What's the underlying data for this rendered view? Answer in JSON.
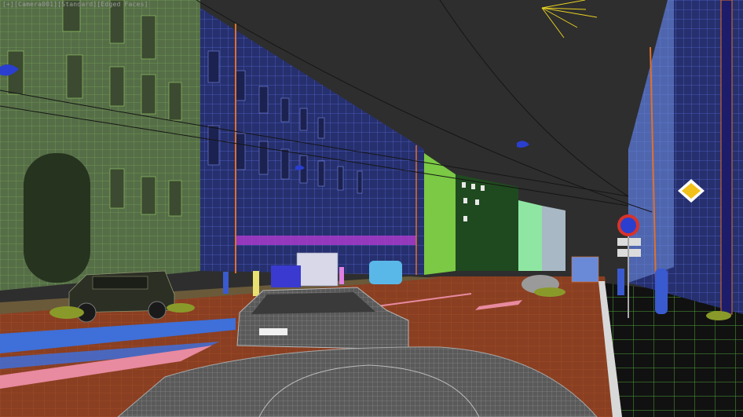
{
  "viewport": {
    "label": "[+][Camera001][Standard][Edged Faces]",
    "colors": {
      "sky": "#2e2e2e",
      "road": "#8a3f22",
      "sidewalk_grid": "#5ea83a",
      "left_building": "#6f8f5a",
      "blue_building": "#4a5fd0",
      "green_building": "#7bc944",
      "crosswalk": "#3f6fd8",
      "pink_marking": "#e88aa0",
      "car": "#8c8c8c",
      "light_orange": "#e0702a"
    },
    "scene_icons": [
      "street-lamp-icon",
      "traffic-sign-icon",
      "diamond-sign-icon",
      "sun-light-icon"
    ]
  }
}
